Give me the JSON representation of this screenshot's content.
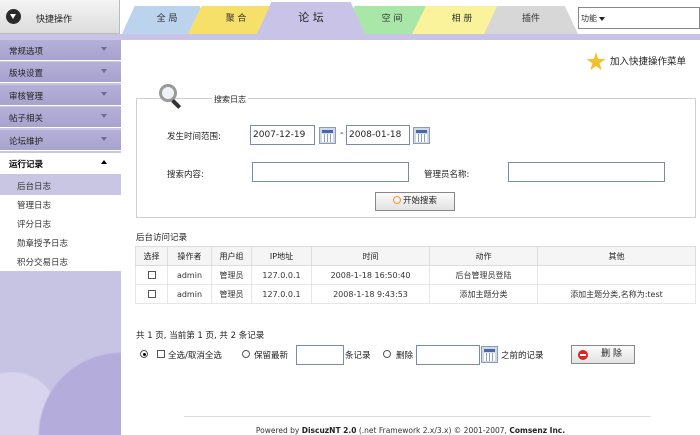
{
  "header": {
    "quick_ops_label": "快捷操作",
    "tabs": [
      {
        "label": "全 局"
      },
      {
        "label": "聚 合"
      },
      {
        "label": "论 坛"
      },
      {
        "label": "空 间"
      },
      {
        "label": "相 册"
      },
      {
        "label": "插件"
      }
    ],
    "function_select": "功能"
  },
  "sidebar": {
    "sections": [
      {
        "label": "常规选项"
      },
      {
        "label": "版块设置"
      },
      {
        "label": "审核管理"
      },
      {
        "label": "帖子相关"
      },
      {
        "label": "论坛维护"
      },
      {
        "label": "运行记录"
      }
    ],
    "subitems": [
      {
        "label": "后台日志"
      },
      {
        "label": "管理日志"
      },
      {
        "label": "评分日志"
      },
      {
        "label": "勋章授予日志"
      },
      {
        "label": "积分交易日志"
      }
    ]
  },
  "main": {
    "add_quick_menu": "加入快捷操作菜单",
    "search": {
      "legend": "搜索日志",
      "time_label": "发生时间范围:",
      "start_date": "2007-12-19",
      "separator": "-",
      "end_date": "2008-01-18",
      "content_label": "搜索内容:",
      "content_value": "",
      "admin_label": "管理员名称:",
      "admin_value": "",
      "search_button": "开始搜索"
    },
    "log_title": "后台访问记录",
    "table": {
      "headers": [
        "选择",
        "操作者",
        "用户组",
        "IP地址",
        "时间",
        "动作",
        "其他"
      ],
      "rows": [
        {
          "operator": "admin",
          "group": "管理员",
          "ip": "127.0.0.1",
          "time": "2008-1-18 16:50:40",
          "action": "后台管理员登陆",
          "other": ""
        },
        {
          "operator": "admin",
          "group": "管理员",
          "ip": "127.0.0.1",
          "time": "2008-1-18 9:43:53",
          "action": "添加主题分类",
          "other": "添加主题分类,名称为:test"
        }
      ]
    },
    "page_info": "共 1 页, 当前第 1 页, 共 2 条记录",
    "ops": {
      "select_all_label": "全选/取消全选",
      "keep_latest_label": "保留最新",
      "records_label": "条记录",
      "delete_label": "删除",
      "before_label": "之前的记录",
      "delete_button": "删 除"
    },
    "footer": {
      "prefix": "Powered by",
      "product": "DiscuzNT 2.0",
      "framework": "(.net Framework 2.x/3.x)",
      "copyright": "© 2001-2007,",
      "company": "Comsenz Inc."
    }
  }
}
